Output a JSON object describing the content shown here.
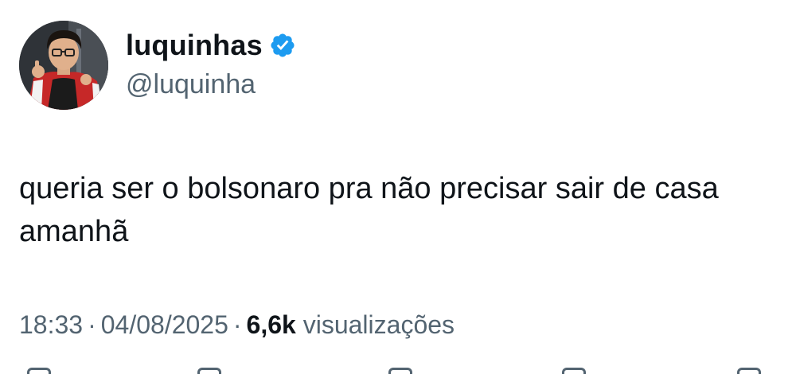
{
  "author": {
    "display_name": "luquinhas",
    "handle": "@luquinha",
    "verified_icon": "verified-badge-icon",
    "verified_color": "#1d9bf0"
  },
  "tweet": {
    "text": "queria ser o bolsonaro pra não precisar sair de casa amanhã"
  },
  "meta": {
    "time": "18:33",
    "separator": "·",
    "date": "04/08/2025",
    "views_count": "6,6k",
    "views_label": "visualizações"
  },
  "actions": [
    {
      "icon": "reply-icon"
    },
    {
      "icon": "retweet-icon"
    },
    {
      "icon": "like-icon"
    },
    {
      "icon": "bookmark-icon"
    },
    {
      "icon": "share-icon"
    }
  ],
  "colors": {
    "text": "#0f1419",
    "secondary": "#536471",
    "accent": "#1d9bf0"
  }
}
